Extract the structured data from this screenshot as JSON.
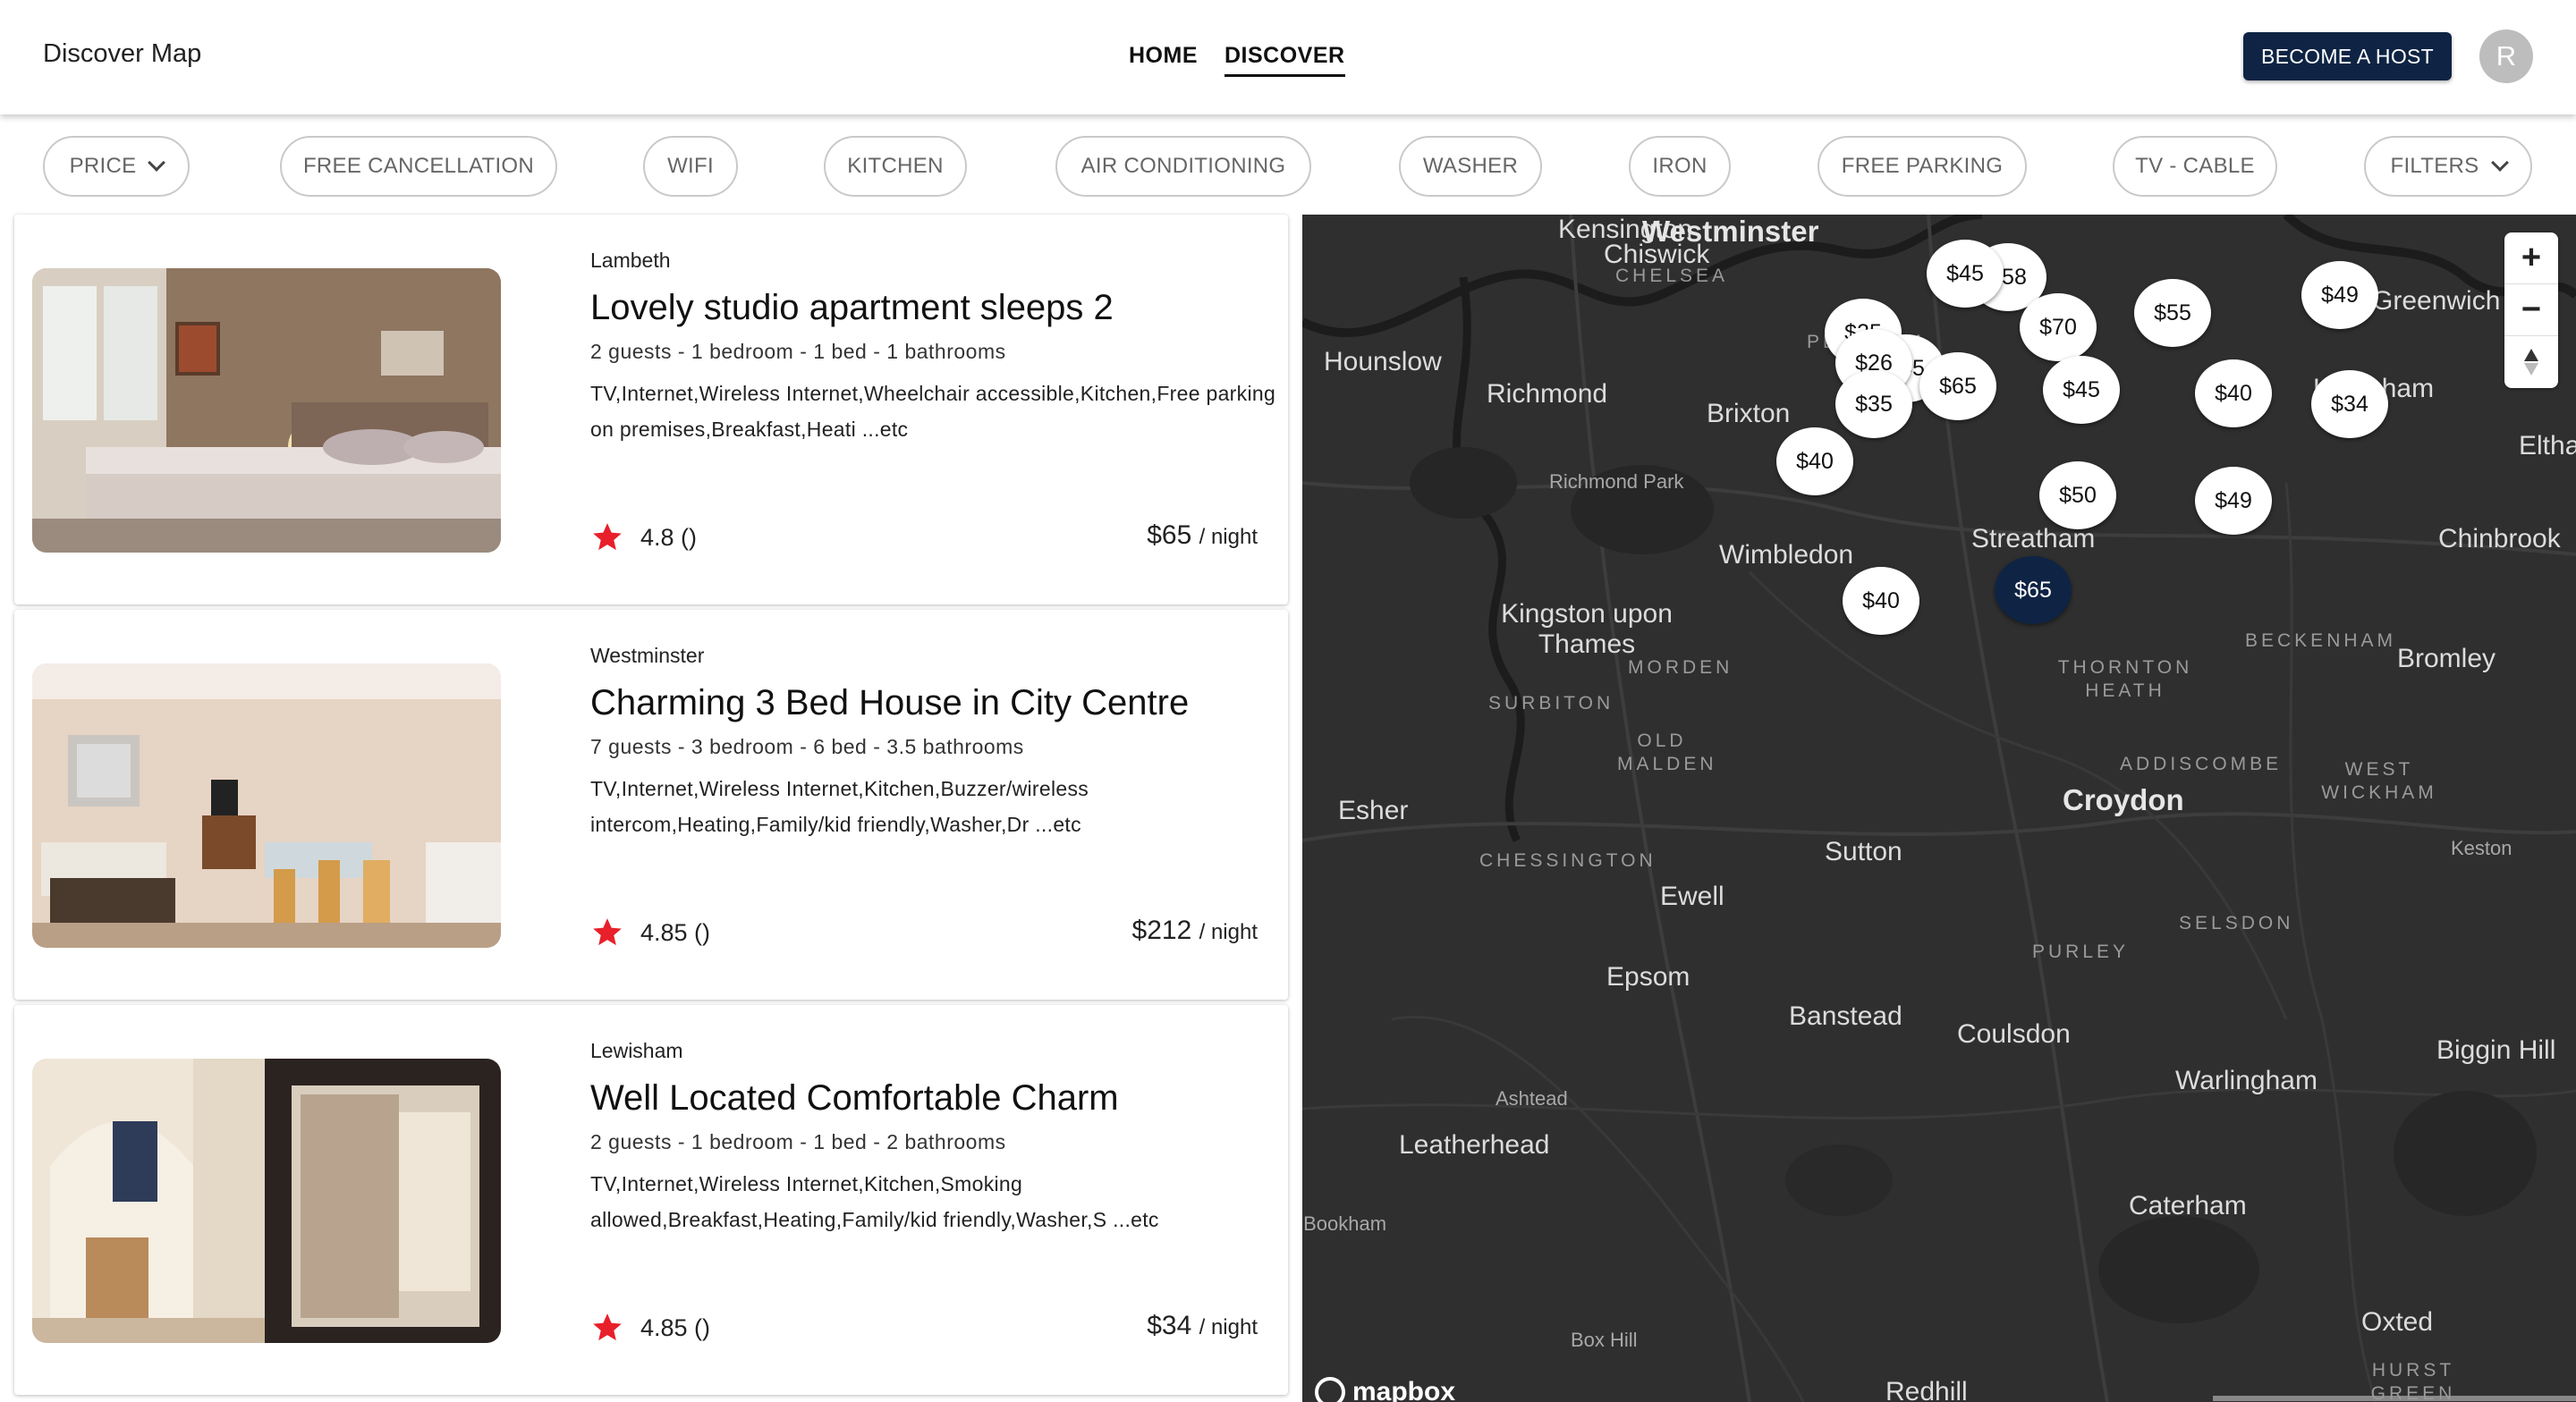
{
  "header": {
    "brand": "Discover Map",
    "nav": [
      {
        "label": "HOME",
        "active": false
      },
      {
        "label": "DISCOVER",
        "active": true
      }
    ],
    "host_button": "BECOME A HOST",
    "avatar_initial": "R"
  },
  "filters": {
    "chips": [
      "PRICE",
      "FREE CANCELLATION",
      "WIFI",
      "KITCHEN",
      "AIR CONDITIONING",
      "WASHER",
      "IRON",
      "FREE PARKING",
      "TV - CABLE",
      "FILTERS"
    ]
  },
  "listings": [
    {
      "location": "Lambeth",
      "title": "Lovely studio apartment sleeps 2",
      "meta": "2 guests - 1 bedroom - 1 bed - 1 bathrooms",
      "amenities": "TV,Internet,Wireless Internet,Wheelchair accessible,Kitchen,Free parking on premises,Breakfast,Heati ...etc",
      "rating": "4.8 ()",
      "price": "$65",
      "price_unit": "/ night"
    },
    {
      "location": "Westminster",
      "title": "Charming 3 Bed House in City Centre",
      "meta": "7 guests - 3 bedroom - 6 bed - 3.5 bathrooms",
      "amenities": "TV,Internet,Wireless Internet,Kitchen,Buzzer/wireless intercom,Heating,Family/kid friendly,Washer,Dr ...etc",
      "rating": "4.85 ()",
      "price": "$212",
      "price_unit": "/ night"
    },
    {
      "location": "Lewisham",
      "title": "Well Located Comfortable Charm",
      "meta": "2 guests - 1 bedroom - 1 bed - 2 bathrooms",
      "amenities": "TV,Internet,Wireless Internet,Kitchen,Smoking allowed,Breakfast,Heating,Family/kid friendly,Washer,S ...etc",
      "rating": "4.85 ()",
      "price": "$34",
      "price_unit": "/ night"
    }
  ],
  "map": {
    "places": [
      "Kensington",
      "Westminster",
      "Chiswick",
      "CHELSEA",
      "Hounslow",
      "Richmond",
      "Richmond Park",
      "Wimbledon",
      "Brixton",
      "Streatham",
      "Kingston upon Thames",
      "MORDEN",
      "SURBITON",
      "OLD MALDEN",
      "THORNTON HEATH",
      "BECKENHAM",
      "Bromley",
      "Chinbrook",
      "ADDISCOMBE",
      "WEST WICKHAM",
      "Croydon",
      "Esher",
      "CHESSINGTON",
      "Sutton",
      "Ewell",
      "Keston",
      "SELSDON",
      "Epsom",
      "PURLEY",
      "Banstead",
      "Coulsdon",
      "Biggin Hill",
      "Warlingham",
      "Ashtead",
      "Leatherhead",
      "Caterham",
      "Great Bookham",
      "Box Hill",
      "Oxted",
      "Redhill",
      "Greenwich",
      "Lewisham",
      "Eltham",
      "PECKHAM",
      "HURST GREEN"
    ],
    "pins": [
      "$45",
      "$58",
      "$70",
      "$55",
      "$49",
      "$25",
      "$26",
      "$45",
      "$65",
      "$35",
      "$45",
      "$40",
      "$34",
      "$40",
      "$50",
      "$49",
      "$40",
      "$65"
    ],
    "selected_pin": "$65",
    "attribution": "mapbox"
  },
  "colors": {
    "navy": "#0f2444",
    "star_red": "#e8202a",
    "map_bg": "#2f2f2f"
  }
}
